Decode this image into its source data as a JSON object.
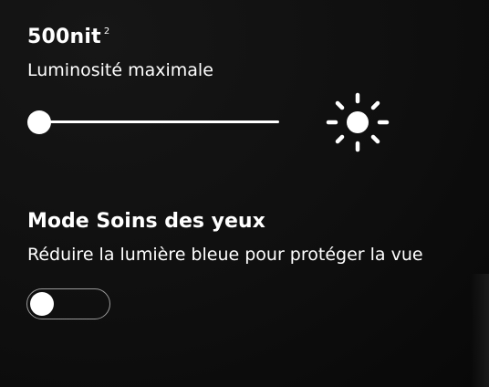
{
  "brightness": {
    "value": "500nit",
    "footnote": "2",
    "label": "Luminosité maximale",
    "slider_level": 0.0
  },
  "eye_care": {
    "title": "Mode Soins des yeux",
    "description": "Réduire la lumière bleue pour protéger la vue",
    "enabled": false
  },
  "icons": {
    "brightness": "sun-icon"
  },
  "colors": {
    "background": "#0d0d0d",
    "foreground": "#ffffff",
    "toggle_border": "#9a9a9a"
  }
}
